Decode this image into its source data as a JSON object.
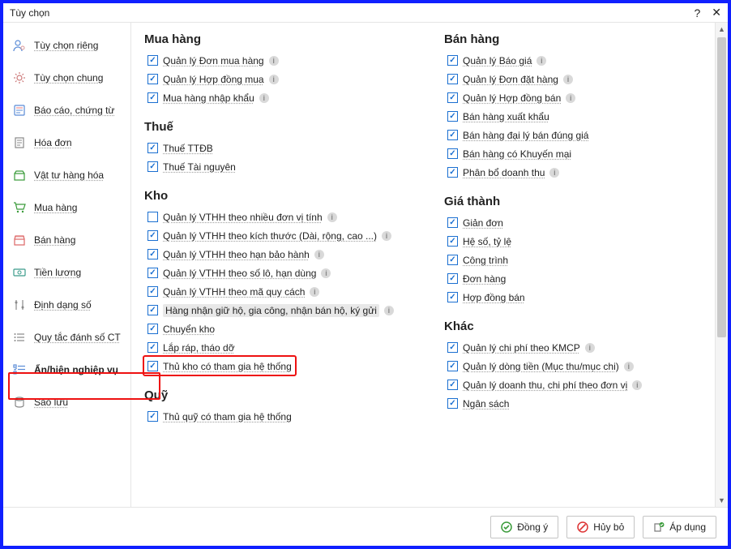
{
  "window": {
    "title": "Tùy chọn"
  },
  "sidebar": {
    "items": [
      {
        "id": "tuy-chon-rieng",
        "label": "Tùy chọn riêng",
        "icon": "user-gear"
      },
      {
        "id": "tuy-chon-chung",
        "label": "Tùy chọn chung",
        "icon": "gear"
      },
      {
        "id": "bao-cao-chung-tu",
        "label": "Báo cáo, chứng từ",
        "icon": "doc"
      },
      {
        "id": "hoa-don",
        "label": "Hóa đơn",
        "icon": "receipt"
      },
      {
        "id": "vat-tu-hang-hoa",
        "label": "Vật tư hàng hóa",
        "icon": "goods"
      },
      {
        "id": "mua-hang",
        "label": "Mua hàng",
        "icon": "cart"
      },
      {
        "id": "ban-hang",
        "label": "Bán hàng",
        "icon": "store"
      },
      {
        "id": "tien-luong",
        "label": "Tiền lương",
        "icon": "money"
      },
      {
        "id": "dinh-dang-so",
        "label": "Định dạng số",
        "icon": "sliders"
      },
      {
        "id": "quy-tac-danh-so-ct",
        "label": "Quy tắc đánh số CT",
        "icon": "list"
      },
      {
        "id": "an-hien-nghiep-vu",
        "label": "Ẩn/hiện nghiệp vụ",
        "icon": "checklist",
        "active": true
      },
      {
        "id": "sao-luu",
        "label": "Sao lưu",
        "icon": "db"
      }
    ]
  },
  "columns": {
    "left": [
      {
        "title": "Mua hàng",
        "items": [
          {
            "label": "Quản lý Đơn mua hàng",
            "checked": true,
            "info": true
          },
          {
            "label": "Quản lý Hợp đồng mua",
            "checked": true,
            "info": true
          },
          {
            "label": "Mua hàng nhập khẩu",
            "checked": true,
            "info": true
          }
        ]
      },
      {
        "title": "Thuế",
        "items": [
          {
            "label": "Thuế TTĐB",
            "checked": true
          },
          {
            "label": "Thuế Tài nguyên",
            "checked": true
          }
        ]
      },
      {
        "title": "Kho",
        "items": [
          {
            "label": "Quản lý VTHH theo nhiều đơn vị tính",
            "checked": false,
            "info": true
          },
          {
            "label": "Quản lý VTHH theo kích thước (Dài, rộng, cao ...)",
            "checked": true,
            "info": true
          },
          {
            "label": "Quản lý VTHH theo hạn bảo hành",
            "checked": true,
            "info": true
          },
          {
            "label": "Quản lý VTHH theo số lô, hạn dùng",
            "checked": true,
            "info": true
          },
          {
            "label": "Quản lý VTHH theo mã quy cách",
            "checked": true,
            "info": true
          },
          {
            "label": "Hàng nhận giữ hộ, gia công, nhận bán hộ, ký gửi",
            "checked": true,
            "info": true,
            "highlight": true
          },
          {
            "label": "Chuyển kho",
            "checked": true
          },
          {
            "label": "Lắp ráp, tháo dỡ",
            "checked": true
          },
          {
            "label": "Thủ kho có tham gia hệ thống",
            "checked": true,
            "redbox": true
          }
        ]
      },
      {
        "title": "Quỹ",
        "items": [
          {
            "label": "Thủ quỹ có tham gia hệ thống",
            "checked": true
          }
        ]
      }
    ],
    "right": [
      {
        "title": "Bán hàng",
        "items": [
          {
            "label": "Quản lý Báo giá",
            "checked": true,
            "info": true
          },
          {
            "label": "Quản lý Đơn đặt hàng",
            "checked": true,
            "info": true
          },
          {
            "label": "Quản lý Hợp đồng bán",
            "checked": true,
            "info": true
          },
          {
            "label": "Bán hàng xuất khẩu",
            "checked": true
          },
          {
            "label": "Bán hàng đại lý bán đúng giá",
            "checked": true
          },
          {
            "label": "Bán hàng có Khuyến mại",
            "checked": true
          },
          {
            "label": "Phân bổ doanh thu",
            "checked": true,
            "info": true
          }
        ]
      },
      {
        "title": "Giá thành",
        "items": [
          {
            "label": "Giản đơn",
            "checked": true
          },
          {
            "label": "Hệ số, tỷ lệ",
            "checked": true
          },
          {
            "label": "Công trình",
            "checked": true
          },
          {
            "label": "Đơn hàng",
            "checked": true
          },
          {
            "label": "Hợp đồng bán",
            "checked": true
          }
        ]
      },
      {
        "title": "Khác",
        "items": [
          {
            "label": "Quản lý chi phí theo KMCP",
            "checked": true,
            "info": true
          },
          {
            "label": "Quản lý dòng tiền (Mục thu/mục chi)",
            "checked": true,
            "info": true
          },
          {
            "label": "Quản lý doanh thu, chi phí theo đơn vị",
            "checked": true,
            "info": true
          },
          {
            "label": "Ngân sách",
            "checked": true
          }
        ]
      }
    ]
  },
  "footer": {
    "ok": "Đồng ý",
    "cancel": "Hủy bỏ",
    "apply": "Áp dụng"
  }
}
